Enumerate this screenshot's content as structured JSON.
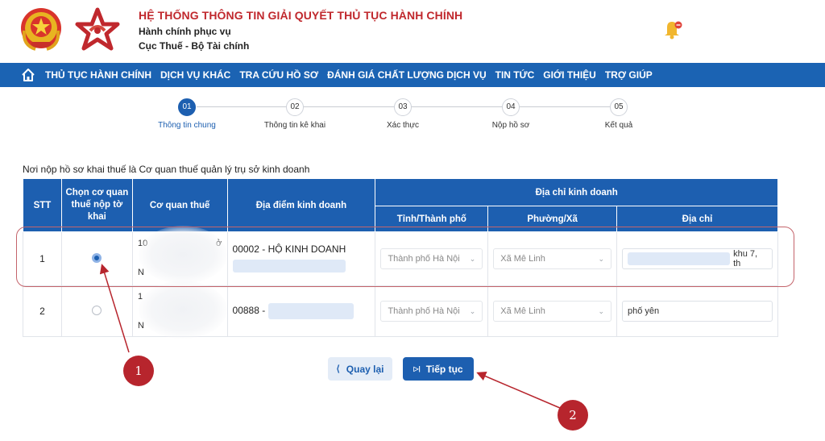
{
  "header": {
    "title": "HỆ THỐNG THÔNG TIN GIẢI QUYẾT THỦ TỤC HÀNH CHÍNH",
    "subtitle1": "Hành chính phục vụ",
    "subtitle2": "Cục Thuế - Bộ Tài chính"
  },
  "nav": {
    "items": [
      "THỦ TỤC HÀNH CHÍNH",
      "DỊCH VỤ KHÁC",
      "TRA CỨU HỒ SƠ",
      "ĐÁNH GIÁ CHẤT LƯỢNG DỊCH VỤ",
      "TIN TỨC",
      "GIỚI THIỆU",
      "TRỢ GIÚP"
    ]
  },
  "steps": [
    {
      "num": "01",
      "label": "Thông tin chung",
      "active": true
    },
    {
      "num": "02",
      "label": "Thông tin kê khai",
      "active": false
    },
    {
      "num": "03",
      "label": "Xác thực",
      "active": false
    },
    {
      "num": "04",
      "label": "Nộp hồ sơ",
      "active": false
    },
    {
      "num": "05",
      "label": "Kết quả",
      "active": false
    }
  ],
  "notice": "Nơi nộp hồ sơ khai thuế là Cơ quan thuế quản lý trụ sở kinh doanh",
  "table": {
    "headers": {
      "stt": "STT",
      "chon": "Chọn cơ quan thuế nộp tờ khai",
      "coquan": "Cơ quan thuế",
      "diadiem": "Địa điểm kinh doanh",
      "diachi_group": "Địa chỉ kinh doanh",
      "tinh": "Tỉnh/Thành phố",
      "phuong": "Phường/Xã",
      "diachi": "Địa chỉ"
    },
    "rows": [
      {
        "stt": "1",
        "selected": true,
        "coquan_fragment_a": "10",
        "coquan_fragment_b": "ở",
        "coquan_fragment_c": "N",
        "diadiem": "00002 - HỘ KINH DOANH",
        "tinh": "Thành phố Hà Nội",
        "phuong": "Xã Mê Linh",
        "diachi": "khu 7, th"
      },
      {
        "stt": "2",
        "selected": false,
        "coquan_fragment_a": "1",
        "coquan_fragment_c": "N",
        "diadiem": "00888 -",
        "tinh": "Thành phố Hà Nội",
        "phuong": "Xã Mê Linh",
        "diachi": "phố yên"
      }
    ]
  },
  "buttons": {
    "back": "Quay lại",
    "next": "Tiếp tục",
    "back_icon": "chevron-left-icon",
    "next_icon": "next-step-icon"
  },
  "annotations": {
    "marker1": "1",
    "marker2": "2",
    "color": "#b7252d"
  },
  "colors": {
    "brand_blue": "#1d5fb0",
    "title_red": "#c0282d"
  }
}
